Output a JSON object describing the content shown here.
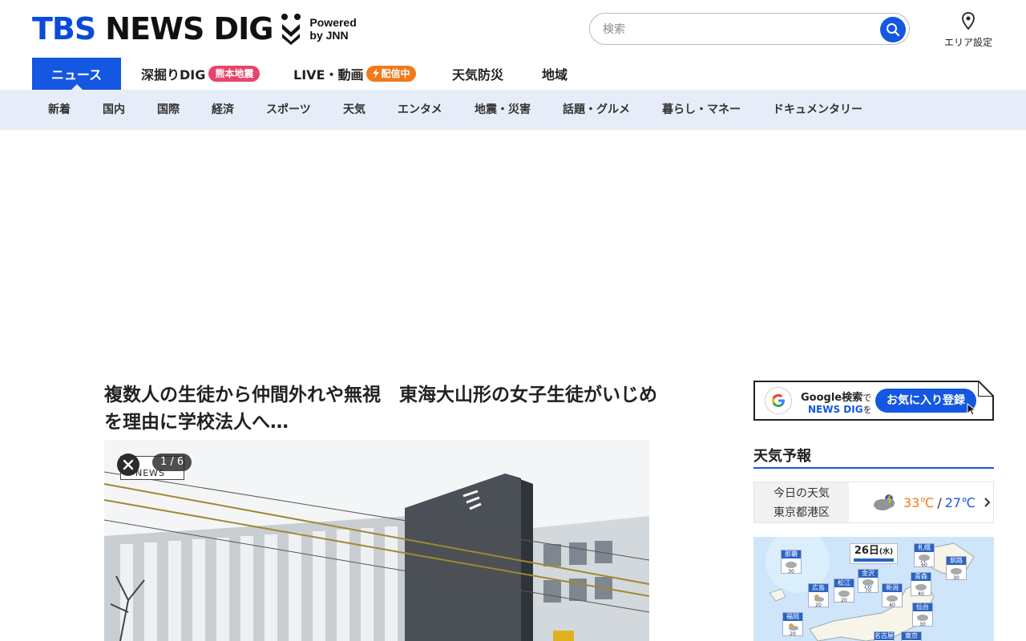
{
  "header": {
    "logo_primary": "TBS",
    "logo_secondary": "NEWS DIG",
    "powered_line1": "Powered",
    "powered_line2": "by JNN",
    "search_placeholder": "検索",
    "area_label": "エリア設定"
  },
  "main_nav": [
    {
      "label": "ニュース",
      "active": true
    },
    {
      "label": "深掘りDIG",
      "badge": "熊本地震"
    },
    {
      "label": "LIVE・動画",
      "badge": "配信中"
    },
    {
      "label": "天気防災"
    },
    {
      "label": "地域"
    }
  ],
  "sub_nav": [
    "新着",
    "国内",
    "国際",
    "経済",
    "スポーツ",
    "天気",
    "エンタメ",
    "地震・災害",
    "話題・グルメ",
    "暮らし・マネー",
    "ドキュメンタリー"
  ],
  "article": {
    "title": "複数人の生徒から仲間外れや無視　東海大山形の女子生徒がいじめを理由に学校法人へ…",
    "photo_counter": "1 / 6",
    "photo_watermark": "NEWS"
  },
  "sidebar": {
    "google_line1": "Google検索",
    "google_line1_suffix": "で",
    "google_line2": "NEWS DIG",
    "google_line2_suffix": "を",
    "google_button": "お気に入り登録",
    "weather_title": "天気予報",
    "weather_today": "今日の天気",
    "weather_location": "東京都港区",
    "temp_high": "33℃",
    "temp_sep": "/",
    "temp_low": "27℃",
    "map_date": "26日",
    "map_weekday": "(水)",
    "map_cities": [
      {
        "name": "那覇",
        "pct": "30"
      },
      {
        "name": "札幌",
        "pct": "60"
      },
      {
        "name": "釧路",
        "pct": "30"
      },
      {
        "name": "青森",
        "pct": "40"
      },
      {
        "name": "広島",
        "pct": "20"
      },
      {
        "name": "松江",
        "pct": "20"
      },
      {
        "name": "金沢",
        "pct": "70"
      },
      {
        "name": "新潟",
        "pct": "40"
      },
      {
        "name": "仙台",
        "pct": "30"
      },
      {
        "name": "福岡",
        "pct": "20"
      },
      {
        "name": "名古屋",
        "pct": ""
      },
      {
        "name": "東京",
        "pct": ""
      }
    ]
  },
  "colors": {
    "brand_blue": "#1457e0",
    "nav_bg": "#e7edf8",
    "badge_pink": "#e8436b",
    "badge_orange": "#f07a1a"
  }
}
